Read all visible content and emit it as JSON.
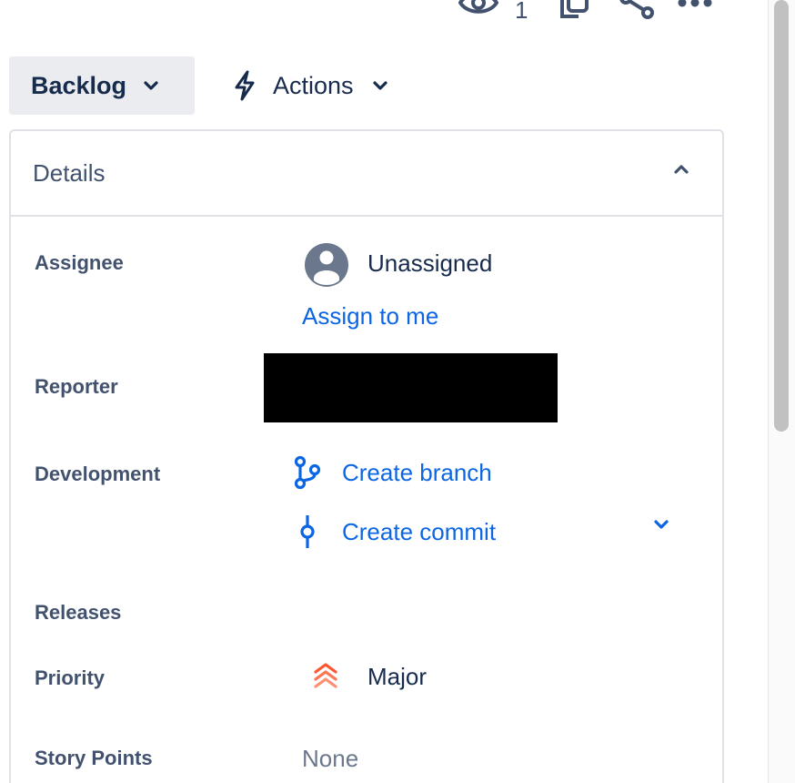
{
  "header": {
    "watch_count": "1",
    "icons": [
      "eye-icon",
      "copy-icon",
      "share-icon",
      "more-icon"
    ]
  },
  "toolbar": {
    "status_label": "Backlog",
    "actions_label": "Actions"
  },
  "details": {
    "title": "Details",
    "assignee": {
      "label": "Assignee",
      "value": "Unassigned",
      "assign_link": "Assign to me"
    },
    "reporter": {
      "label": "Reporter"
    },
    "development": {
      "label": "Development",
      "create_branch": "Create branch",
      "create_commit": "Create commit"
    },
    "releases": {
      "label": "Releases"
    },
    "priority": {
      "label": "Priority",
      "value": "Major",
      "color": "#ff5630"
    },
    "story_points": {
      "label": "Story Points",
      "value": "None"
    }
  },
  "colors": {
    "link": "#0c66e4",
    "text": "#172b4d",
    "subtle": "#42526e",
    "border": "#dfe1e6"
  }
}
